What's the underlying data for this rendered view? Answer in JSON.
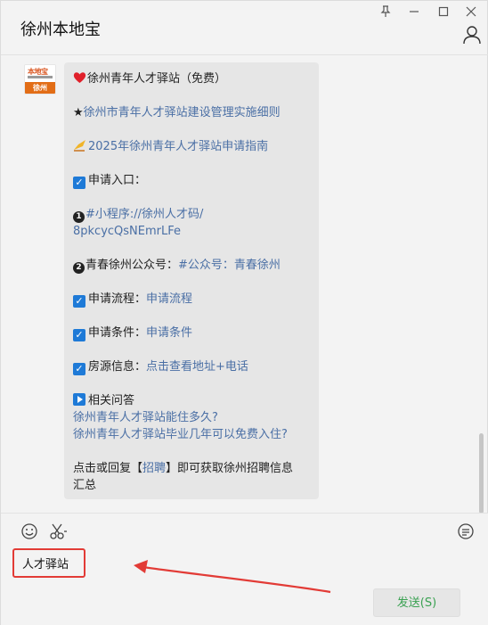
{
  "window": {
    "title": "徐州本地宝",
    "controls": [
      "pin-icon",
      "minimize-icon",
      "maximize-icon",
      "close-icon"
    ]
  },
  "avatar": {
    "brand": "本地宝",
    "city": "徐州"
  },
  "message": {
    "line1": "徐州青年人才驿站（免费）",
    "line2_star": "★",
    "line2_link": "徐州市青年人才驿站建设管理实施细则",
    "line3_link": "2025年徐州青年人才驿站申请指南",
    "line4": "申请入口：",
    "line5_num": "1",
    "line5_link": "#小程序://徐州人才码/",
    "line6_link": "8pkcycQsNEmrLFe",
    "line7_num": "2",
    "line7_text": "青春徐州公众号：",
    "line7_link": "#公众号：青春徐州",
    "line8_text": "申请流程：",
    "line8_link": "申请流程",
    "line9_text": "申请条件：",
    "line9_link": "申请条件",
    "line10_text": "房源信息：",
    "line10_link": "点击查看地址+电话",
    "line11": "相关问答",
    "line12_link": "徐州青年人才驿站能住多久?",
    "line13_link": "徐州青年人才驿站毕业几年可以免费入住?",
    "line14_a": "点击或回复【",
    "line14_link": "招聘",
    "line14_b": "】即可获取徐州招聘信息",
    "line15": "汇总"
  },
  "input": {
    "value": "人才驿站"
  },
  "send_button": {
    "label": "发送(S)"
  },
  "colors": {
    "link": "#4a6fa5",
    "send_text": "#3aa152",
    "highlight": "#e23b36"
  }
}
